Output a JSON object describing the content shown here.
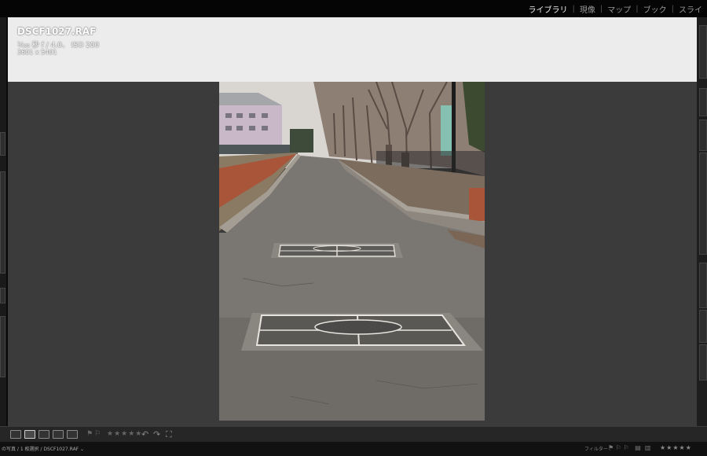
{
  "modules": [
    "ライブラリ",
    "現像",
    "マップ",
    "ブック",
    "スライ"
  ],
  "active_module": "ライブラリ",
  "info": {
    "filename": "DSCF1027.RAF",
    "exif": "¹⁄₄₀₀ 秒 f / 4.0、 ISO 200",
    "dimensions": "3601 x 5401"
  },
  "toolbar": {
    "view_icons": [
      "grid-view-icon",
      "loupe-view-icon",
      "compare-view-icon",
      "survey-view-icon",
      "people-view-icon"
    ],
    "active_view": "loupe-view-icon",
    "stars": "★★★★★",
    "flag_icons": [
      "pick-flag-icon",
      "reject-flag-icon"
    ],
    "rotate_icons": [
      "rotate-left-icon",
      "rotate-right-icon"
    ]
  },
  "filmstrip": {
    "source": "の写真 / 1 枚選択 / DSCF1027.RAF ⌄",
    "filter_label": "フィルター :",
    "stars": "★★★★★"
  },
  "colors": {
    "background": "#0b0b0b",
    "workspace": "#3b3b3b",
    "info_overlay": "#ececec",
    "active_module": "#f2f2f2",
    "inactive_module": "#9a9a9a"
  }
}
